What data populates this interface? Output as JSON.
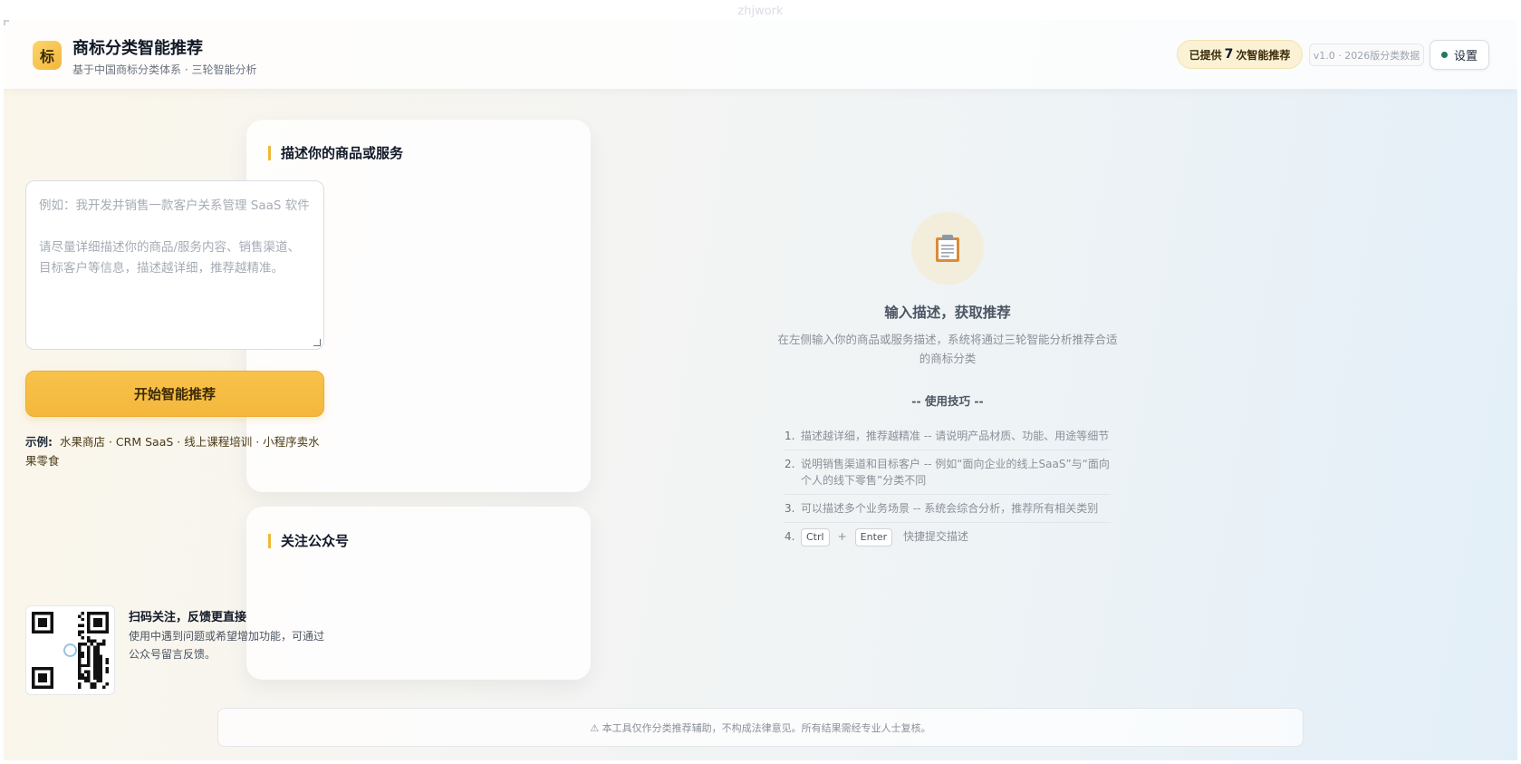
{
  "browser": {
    "tag": "zhjwork"
  },
  "header": {
    "logo_char": "标",
    "title": "商标分类智能推荐",
    "subtitle": "基于中国商标分类体系 · 三轮智能分析",
    "count_prefix": "已提供",
    "count_value": "7",
    "count_suffix": "次智能推荐",
    "version": "v1.0 · 2026版分类数据",
    "settings_label": "设置",
    "status_color": "#1f7a5a"
  },
  "input_card": {
    "title": "描述你的商品或服务",
    "placeholder": "例如：我开发并销售一款客户关系管理 SaaS 软件\n\n请尽量详细描述你的商品/服务内容、销售渠道、目标客户等信息，描述越详细，推荐越精准。",
    "value": "",
    "submit_label": "开始智能推荐",
    "examples_label": "示例:",
    "examples": [
      "水果商店",
      "CRM SaaS",
      "线上课程培训",
      "小程序卖水果零食"
    ],
    "separator": " · "
  },
  "wechat_card": {
    "title": "关注公众号",
    "qr_label": "qr-code",
    "headline": "扫码关注，反馈更直接",
    "description": "使用中遇到问题或希望增加功能，可通过公众号留言反馈。"
  },
  "empty_state": {
    "icon": "clipboard-icon",
    "title": "输入描述，获取推荐",
    "description": "在左侧输入你的商品或服务描述，系统将通过三轮智能分析推荐合适的商标分类",
    "tips_heading": "-- 使用技巧 --",
    "tips": [
      {
        "n": "1.",
        "text": "描述越详细，推荐越精准 -- 请说明产品材质、功能、用途等细节"
      },
      {
        "n": "2.",
        "text": "说明销售渠道和目标客户 -- 例如“面向企业的线上SaaS”与“面向个人的线下零售”分类不同"
      },
      {
        "n": "3.",
        "text": "可以描述多个业务场景 -- 系统会综合分析，推荐所有相关类别"
      }
    ],
    "shortcut": {
      "n": "4.",
      "key1": "Ctrl",
      "plus": "+",
      "key2": "Enter",
      "text": "快捷提交描述"
    }
  },
  "footer": {
    "notice": "⚠ 本工具仅作分类推荐辅助，不构成法律意见。所有结果需经专业人士复核。"
  },
  "colors": {
    "accent": "#f4b73c",
    "accent_dark": "#e9ad34",
    "text": "#111827",
    "muted": "#8b9099"
  }
}
